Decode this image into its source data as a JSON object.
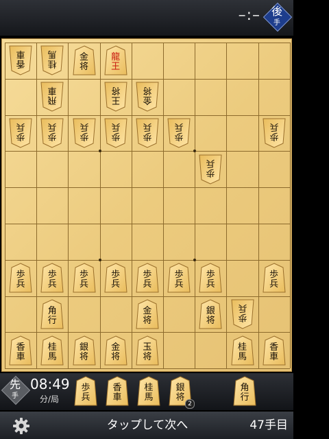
{
  "gote": {
    "time": "–:–",
    "badge": "後",
    "badge_sub": "手"
  },
  "sente": {
    "badge": "先",
    "badge_sub": "手",
    "time": "08:49",
    "time_unit": "分/局"
  },
  "colors": {
    "board": "#eccb7e",
    "grid": "#8c6a2c",
    "promoted": "#c8180f",
    "gote_badge": "#1d3d8c"
  },
  "board": {
    "pieces": [
      {
        "owner": "gote",
        "col": 0,
        "row": 0,
        "top": "香",
        "bottom": "車"
      },
      {
        "owner": "gote",
        "col": 1,
        "row": 0,
        "top": "桂",
        "bottom": "馬"
      },
      {
        "owner": "sente",
        "col": 2,
        "row": 0,
        "top": "金",
        "bottom": "将"
      },
      {
        "owner": "sente",
        "col": 3,
        "row": 0,
        "top": "龍",
        "bottom": "王",
        "promoted": true
      },
      {
        "owner": "gote",
        "col": 1,
        "row": 1,
        "top": "飛",
        "bottom": "車"
      },
      {
        "owner": "gote",
        "col": 3,
        "row": 1,
        "top": "王",
        "bottom": "将"
      },
      {
        "owner": "gote",
        "col": 4,
        "row": 1,
        "top": "金",
        "bottom": "将"
      },
      {
        "owner": "gote",
        "col": 0,
        "row": 2,
        "top": "歩",
        "bottom": "兵"
      },
      {
        "owner": "gote",
        "col": 1,
        "row": 2,
        "top": "歩",
        "bottom": "兵"
      },
      {
        "owner": "gote",
        "col": 2,
        "row": 2,
        "top": "歩",
        "bottom": "兵"
      },
      {
        "owner": "gote",
        "col": 3,
        "row": 2,
        "top": "歩",
        "bottom": "兵"
      },
      {
        "owner": "gote",
        "col": 4,
        "row": 2,
        "top": "歩",
        "bottom": "兵"
      },
      {
        "owner": "gote",
        "col": 5,
        "row": 2,
        "top": "歩",
        "bottom": "兵"
      },
      {
        "owner": "gote",
        "col": 8,
        "row": 2,
        "top": "歩",
        "bottom": "兵"
      },
      {
        "owner": "gote",
        "col": 6,
        "row": 3,
        "top": "歩",
        "bottom": "兵"
      },
      {
        "owner": "sente",
        "col": 0,
        "row": 6,
        "top": "歩",
        "bottom": "兵"
      },
      {
        "owner": "sente",
        "col": 1,
        "row": 6,
        "top": "歩",
        "bottom": "兵"
      },
      {
        "owner": "sente",
        "col": 2,
        "row": 6,
        "top": "歩",
        "bottom": "兵"
      },
      {
        "owner": "sente",
        "col": 3,
        "row": 6,
        "top": "歩",
        "bottom": "兵"
      },
      {
        "owner": "sente",
        "col": 4,
        "row": 6,
        "top": "歩",
        "bottom": "兵"
      },
      {
        "owner": "sente",
        "col": 5,
        "row": 6,
        "top": "歩",
        "bottom": "兵"
      },
      {
        "owner": "sente",
        "col": 6,
        "row": 6,
        "top": "歩",
        "bottom": "兵"
      },
      {
        "owner": "sente",
        "col": 8,
        "row": 6,
        "top": "歩",
        "bottom": "兵"
      },
      {
        "owner": "sente",
        "col": 1,
        "row": 7,
        "top": "角",
        "bottom": "行"
      },
      {
        "owner": "sente",
        "col": 4,
        "row": 7,
        "top": "金",
        "bottom": "将"
      },
      {
        "owner": "sente",
        "col": 6,
        "row": 7,
        "top": "銀",
        "bottom": "将"
      },
      {
        "owner": "gote",
        "col": 7,
        "row": 7,
        "top": "歩",
        "bottom": "兵"
      },
      {
        "owner": "sente",
        "col": 0,
        "row": 8,
        "top": "香",
        "bottom": "車"
      },
      {
        "owner": "sente",
        "col": 1,
        "row": 8,
        "top": "桂",
        "bottom": "馬"
      },
      {
        "owner": "sente",
        "col": 2,
        "row": 8,
        "top": "銀",
        "bottom": "将"
      },
      {
        "owner": "sente",
        "col": 3,
        "row": 8,
        "top": "金",
        "bottom": "将"
      },
      {
        "owner": "sente",
        "col": 4,
        "row": 8,
        "top": "玉",
        "bottom": "将"
      },
      {
        "owner": "sente",
        "col": 7,
        "row": 8,
        "top": "桂",
        "bottom": "馬"
      },
      {
        "owner": "sente",
        "col": 8,
        "row": 8,
        "top": "香",
        "bottom": "車"
      }
    ]
  },
  "hand": [
    {
      "top": "歩",
      "bottom": "兵",
      "count": null
    },
    {
      "top": "香",
      "bottom": "車",
      "count": null
    },
    {
      "top": "桂",
      "bottom": "馬",
      "count": null
    },
    {
      "top": "銀",
      "bottom": "将",
      "count": "2"
    },
    {
      "top": "角",
      "bottom": "行",
      "count": null
    }
  ],
  "status": {
    "prompt": "タップして次へ",
    "move": "47手目",
    "settings_icon": "gear-icon"
  }
}
